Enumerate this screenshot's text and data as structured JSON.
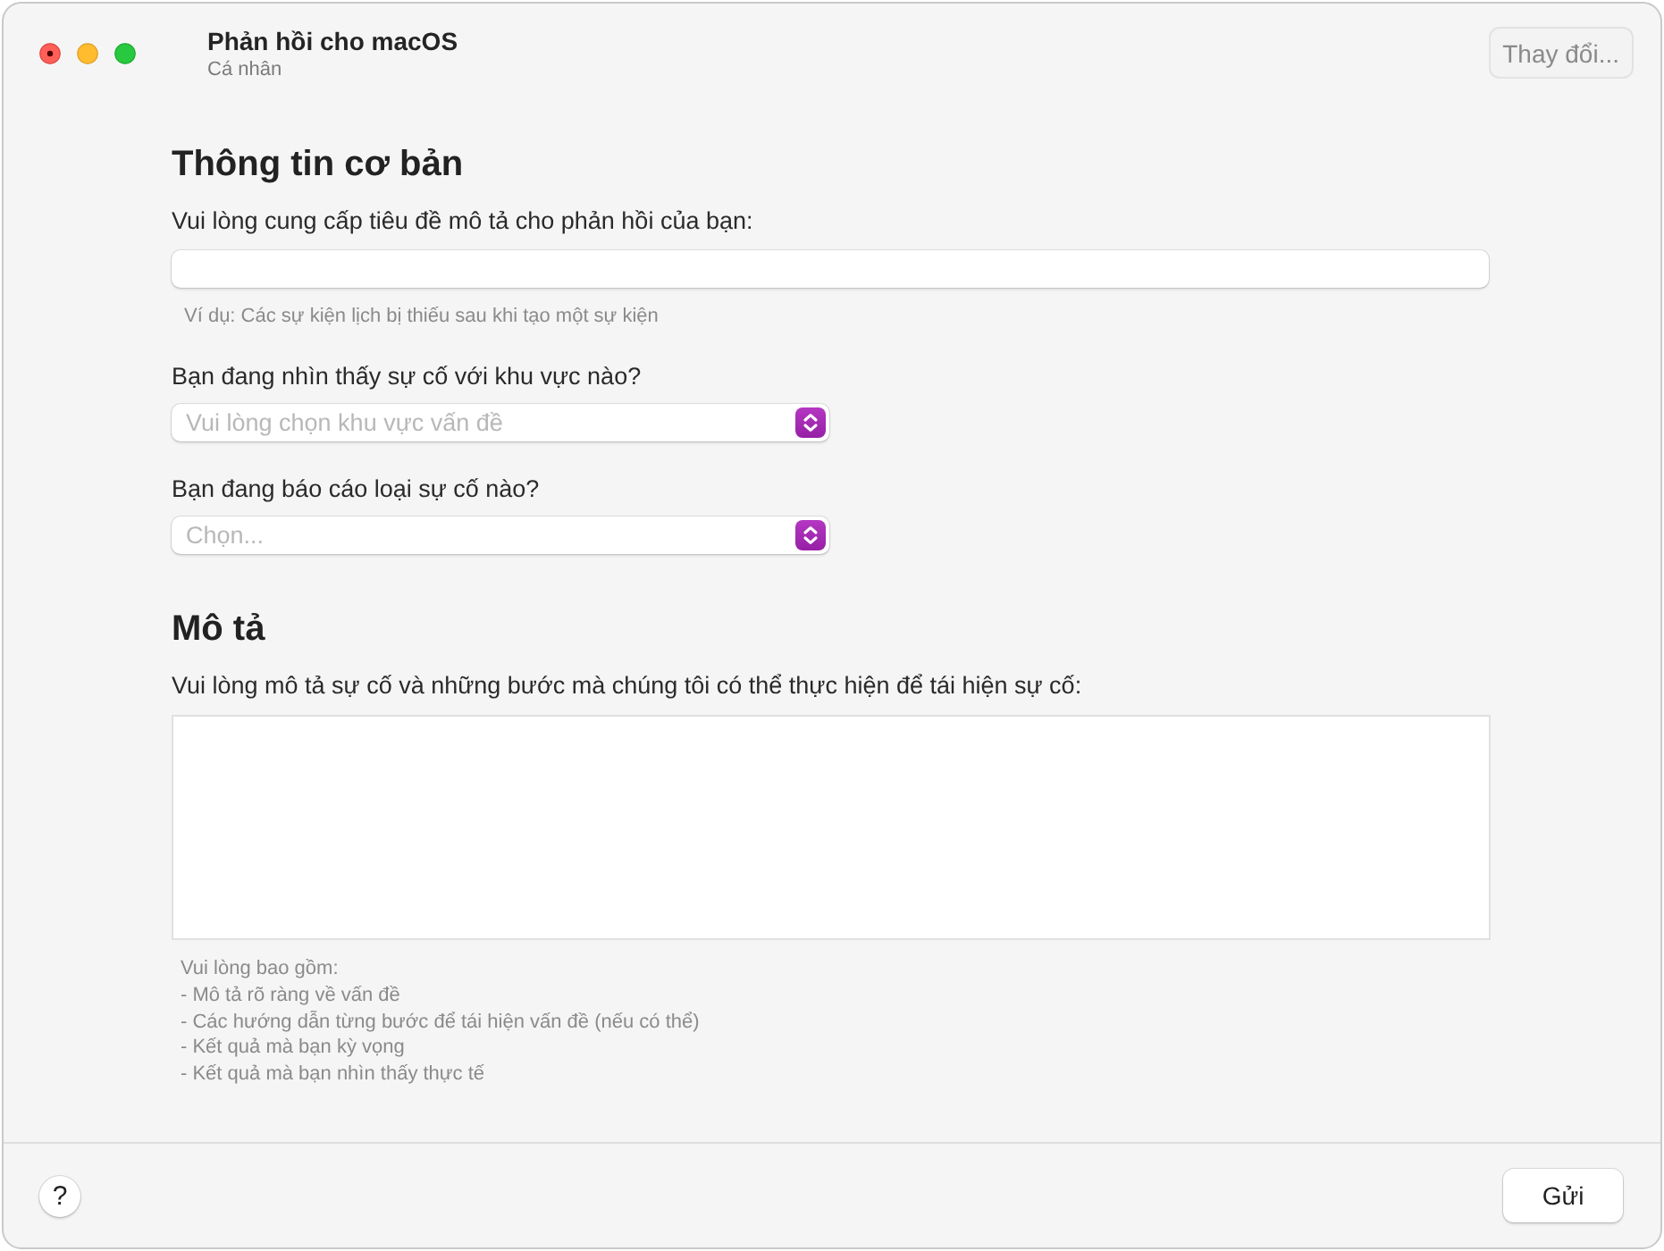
{
  "window": {
    "title": "Phản hồi cho macOS",
    "subtitle": "Cá nhân",
    "change_button": "Thay đổi..."
  },
  "sections": [
    {
      "heading": "Thông tin cơ bản",
      "fields": [
        {
          "kind": "text",
          "label": "Vui lòng cung cấp tiêu đề mô tả cho phản hồi của bạn:",
          "hint_lines": [
            "Ví dụ: Các sự kiện lịch bị thiếu sau khi tạo một sự kiện"
          ]
        },
        {
          "kind": "select",
          "label": "Bạn đang nhìn thấy sự cố với khu vực nào?",
          "placeholder": "Vui lòng chọn khu vực vấn đề"
        },
        {
          "kind": "select",
          "label": "Bạn đang báo cáo loại sự cố nào?",
          "placeholder": "Chọn..."
        }
      ]
    },
    {
      "heading": "Mô tả",
      "fields": [
        {
          "kind": "textarea",
          "label": "Vui lòng mô tả sự cố và những bước mà chúng tôi có thể thực hiện để tái hiện sự cố:",
          "hint_lines": [
            "Vui lòng bao gồm:",
            "- Mô tả rõ ràng về vấn đề",
            "- Các hướng dẫn từng bước để tái hiện vấn đề (nếu có thể)",
            "- Kết quả mà bạn kỳ vọng",
            "- Kết quả mà bạn nhìn thấy thực tế"
          ]
        }
      ]
    }
  ],
  "footer": {
    "help_button": "?",
    "submit_button": "Gửi"
  }
}
